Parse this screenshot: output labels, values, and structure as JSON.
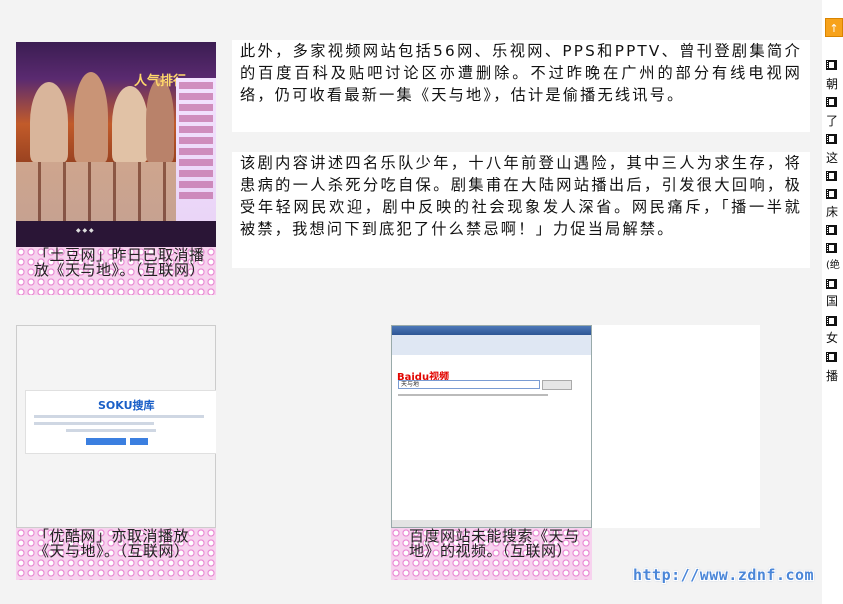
{
  "article": {
    "paragraph1": "此外，多家视频网站包括56网、乐视网、PPS和PPTV、曾刊登剧集简介的百度百科及贴吧讨论区亦遭删除。不过昨晚在广州的部分有线电视网络，仍可收看最新一集《天与地》，估计是偷播无线讯号。",
    "paragraph2": "该剧内容讲述四名乐队少年，十八年前登山遇险，其中三人为求生存，将患病的一人杀死分吃自保。剧集甫在大陆网站播出后，引发很大回响，极受年轻网民欢迎，剧中反映的社会现象发人深省。网民痛斥，「播一半就被禁，我想问下到底犯了什么禁忌啊！」力促当局解禁。"
  },
  "figures": {
    "tudou": {
      "caption": "「土豆网」昨日已取消播放《天与地》。（互联网）",
      "image_text": "人气排行"
    },
    "youku": {
      "caption": "「优酷网」亦取消播放《天与地》。（互联网）",
      "image_text": "SOKU搜库"
    },
    "baidu": {
      "caption": "百度网站未能搜索《天与地》的视频。（互联网）",
      "image_text": "Baidu视频",
      "search_text": "天与地"
    }
  },
  "sidebar": {
    "top_button": "↑",
    "items": [
      "朝",
      "了",
      "这",
      "",
      "床",
      "",
      "(绝",
      "国",
      "女",
      "播"
    ]
  },
  "watermark": "http://www.zdnf.com",
  "colors": {
    "caption_pink": "#f7d2ee",
    "caption_dot": "#e98bd4",
    "sidebar_accent": "#f7a21b",
    "watermark": "#4a86d8"
  }
}
